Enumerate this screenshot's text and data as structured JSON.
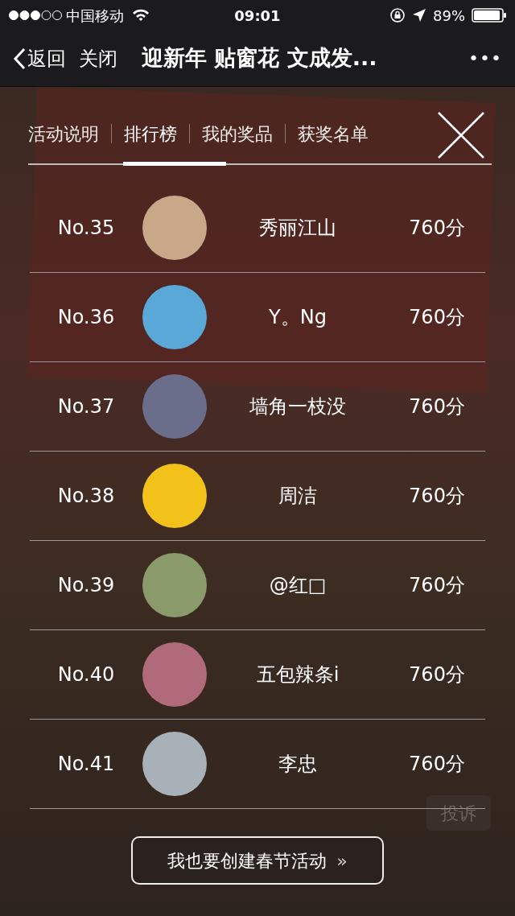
{
  "status_bar": {
    "carrier": "中国移动",
    "time": "09:01",
    "battery": "89%"
  },
  "nav": {
    "back": "返回",
    "close": "关闭",
    "title": "迎新年 贴窗花 文成发...",
    "more": "•••"
  },
  "tabs": [
    {
      "label": "活动说明",
      "selected": false
    },
    {
      "label": "排行榜",
      "selected": true
    },
    {
      "label": "我的奖品",
      "selected": false
    },
    {
      "label": "获奖名单",
      "selected": false
    }
  ],
  "ranking": [
    {
      "rank": "No.35",
      "name": "秀丽江山",
      "score": "760分"
    },
    {
      "rank": "No.36",
      "name": "Y。Ng",
      "score": "760分"
    },
    {
      "rank": "No.37",
      "name": "墙角一枝没",
      "score": "760分"
    },
    {
      "rank": "No.38",
      "name": "周洁",
      "score": "760分"
    },
    {
      "rank": "No.39",
      "name": "@红□",
      "score": "760分"
    },
    {
      "rank": "No.40",
      "name": "五包辣条i",
      "score": "760分"
    },
    {
      "rank": "No.41",
      "name": "李忠",
      "score": "760分"
    }
  ],
  "report_button": "投诉",
  "create_button": {
    "label": "我也要创建春节活动",
    "arrow": "»"
  }
}
